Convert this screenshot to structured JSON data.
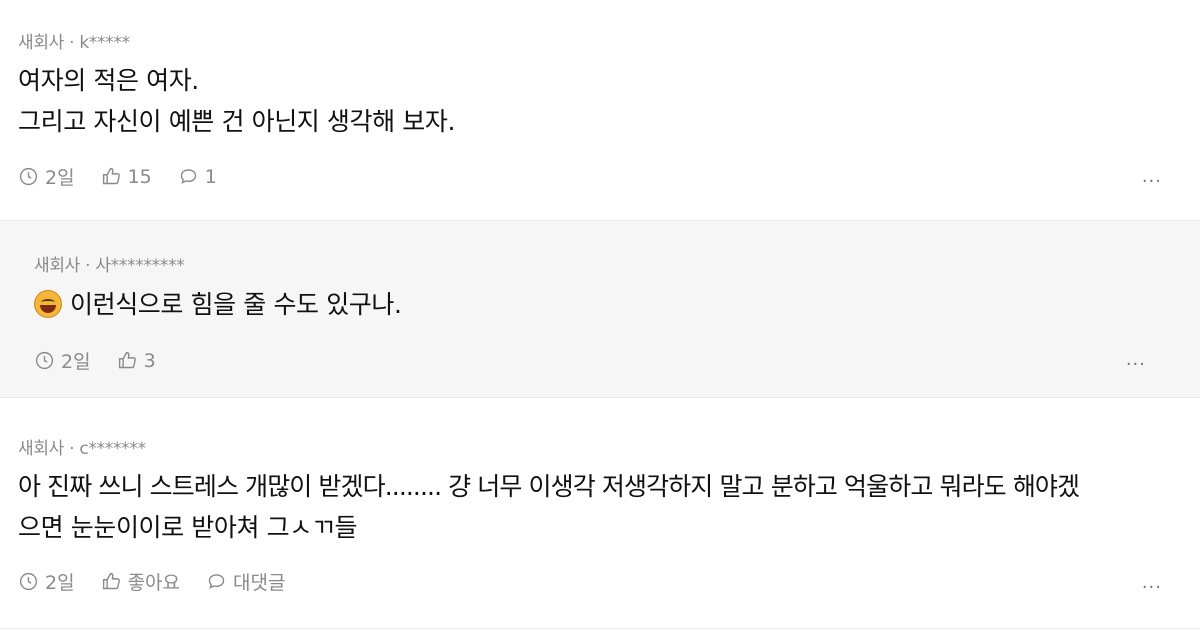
{
  "comments": [
    {
      "meta": "새회사 · k*****",
      "lines": [
        "여자의 적은 여자.",
        "그리고 자신이 예쁜 건 아닌지 생각해 보자."
      ],
      "time": "2일",
      "likes": "15",
      "replies": "1",
      "more": "..."
    },
    {
      "meta": "새회사 · 사*********",
      "emoji_icon": "grinning-squinting-face-icon",
      "text": "이런식으로 힘을 줄 수도 있구나.",
      "time": "2일",
      "likes": "3",
      "more": "..."
    },
    {
      "meta": "새회사 · c*******",
      "lines": [
        "아 진짜 쓰니 스트레스 개많이 받겠다........ 걍 너무 이생각 저생각하지 말고 분하고 억울하고 뭐라도 해야겠",
        "으면 눈눈이이로 받아쳐 그ㅅㄲ들"
      ],
      "time": "2일",
      "likes": "좋아요",
      "replies": "대댓글",
      "more": "..."
    }
  ],
  "icons": {
    "time": "clock-icon",
    "like": "thumbs-up-icon",
    "reply": "speech-bubble-icon",
    "more": "more-dots-icon"
  },
  "colors": {
    "meta_text": "#8a8a8a",
    "reply_bg": "#f6f6f6"
  }
}
